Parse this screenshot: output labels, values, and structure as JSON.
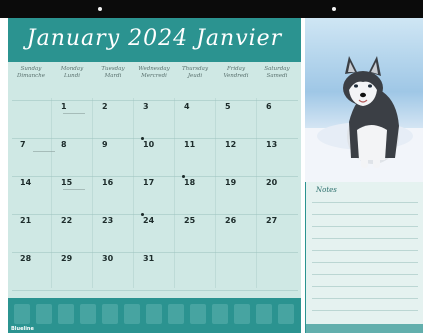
{
  "calendar": {
    "title": "January 2024 Janvier",
    "day_names": [
      "Sunday Dimanche",
      "Monday Lundi",
      "Tuesday Mardi",
      "Wednesday Mercredi",
      "Thursday Jeudi",
      "Friday Vendredi",
      "Saturday Samedi"
    ],
    "weeks": [
      [
        "",
        "1",
        "2",
        "3",
        "4",
        "5",
        "6"
      ],
      [
        "7",
        "8",
        "9",
        "10",
        "11",
        "12",
        "13"
      ],
      [
        "14",
        "15",
        "16",
        "17",
        "18",
        "19",
        "20"
      ],
      [
        "21",
        "22",
        "23",
        "24",
        "25",
        "26",
        "27"
      ],
      [
        "28",
        "29",
        "30",
        "31",
        "",
        "",
        ""
      ]
    ],
    "brand": "Blueline"
  },
  "notes": {
    "title": "Notes"
  },
  "colors": {
    "accent": "#2b9390",
    "grid_background": "#cfe8e4",
    "notes_background": "#e5f2f0"
  }
}
